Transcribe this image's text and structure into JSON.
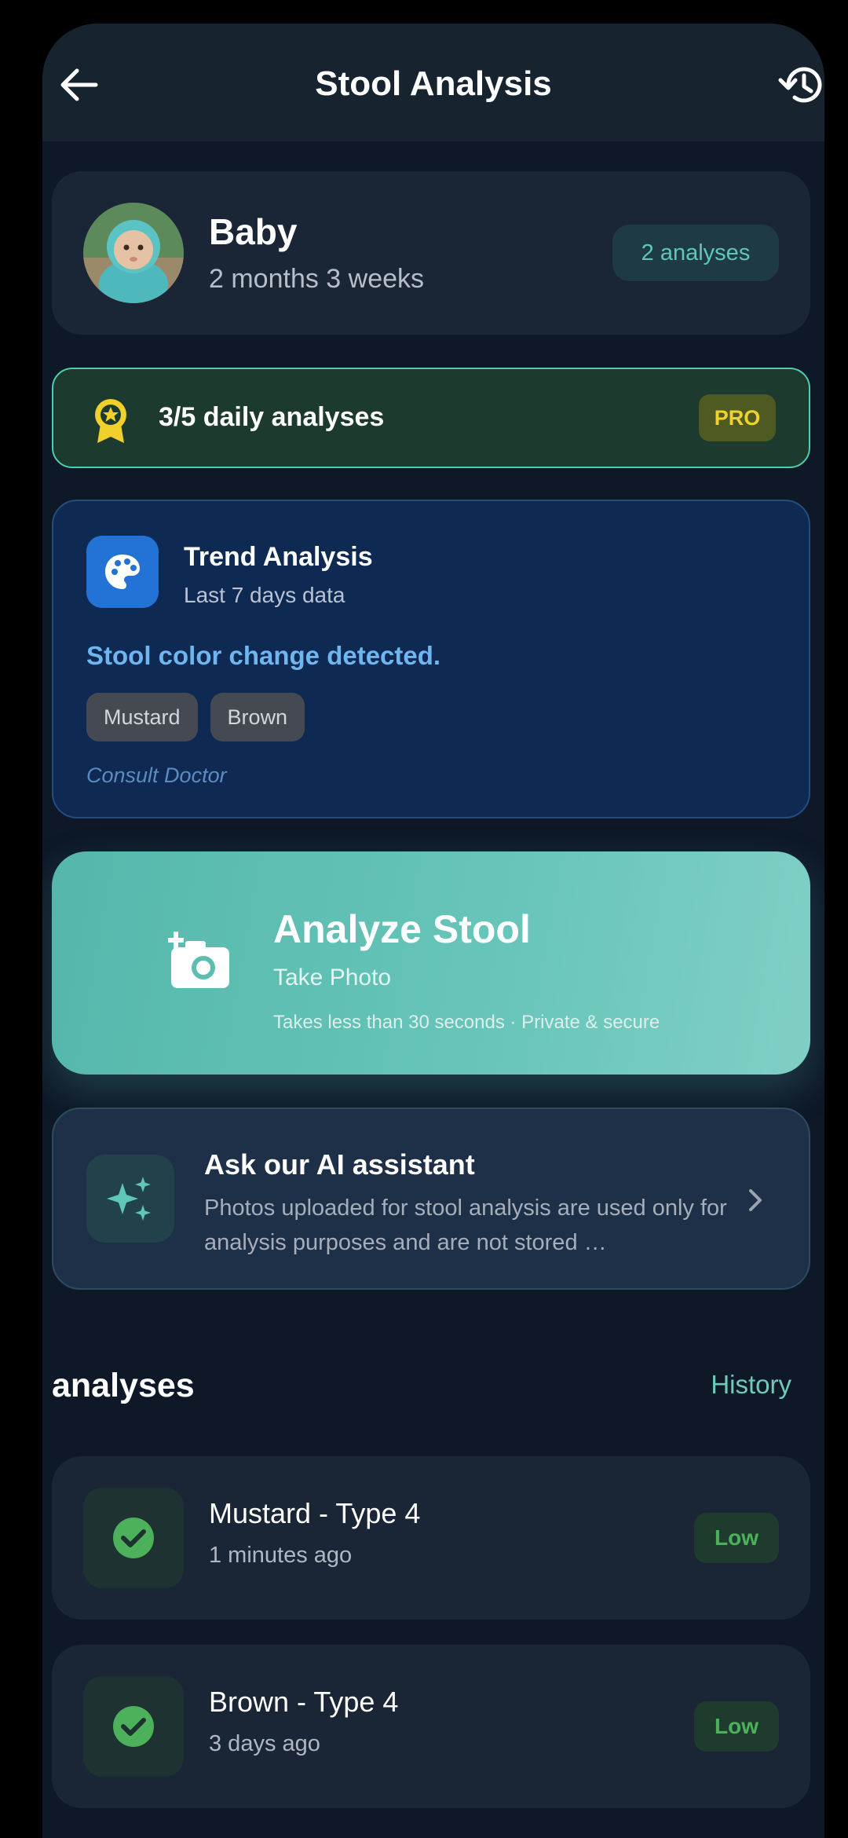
{
  "header": {
    "title": "Stool Analysis",
    "back_icon": "arrow-left-icon",
    "history_icon": "history-icon"
  },
  "profile": {
    "name": "Baby",
    "age": "2 months 3 weeks",
    "analyses_count": "2 analyses"
  },
  "daily_limit": {
    "text": "3/5 daily analyses",
    "badge": "PRO",
    "used": 3,
    "total": 5,
    "accent": "#4fcdb0"
  },
  "trend": {
    "title": "Trend Analysis",
    "subtitle": "Last 7 days data",
    "alert": "Stool color change detected.",
    "tags": [
      "Mustard",
      "Brown"
    ],
    "action": "Consult Doctor",
    "icon": "palette-icon"
  },
  "analyze": {
    "title": "Analyze Stool",
    "subtitle": "Take Photo",
    "note": "Takes less than 30 seconds · Private & secure",
    "icon": "add-camera-icon"
  },
  "ai": {
    "title": "Ask our AI assistant",
    "description": "Photos uploaded for stool analysis are used only for analysis purposes and are not stored …",
    "icon": "sparkles-icon"
  },
  "section": {
    "title": "analyses",
    "link": "History"
  },
  "analyses": [
    {
      "title": "Mustard - Type 4",
      "time": "1 minutes ago",
      "risk": "Low",
      "status_color": "#4cb15a"
    },
    {
      "title": "Brown - Type 4",
      "time": "3 days ago",
      "risk": "Low",
      "status_color": "#4cb15a"
    }
  ]
}
